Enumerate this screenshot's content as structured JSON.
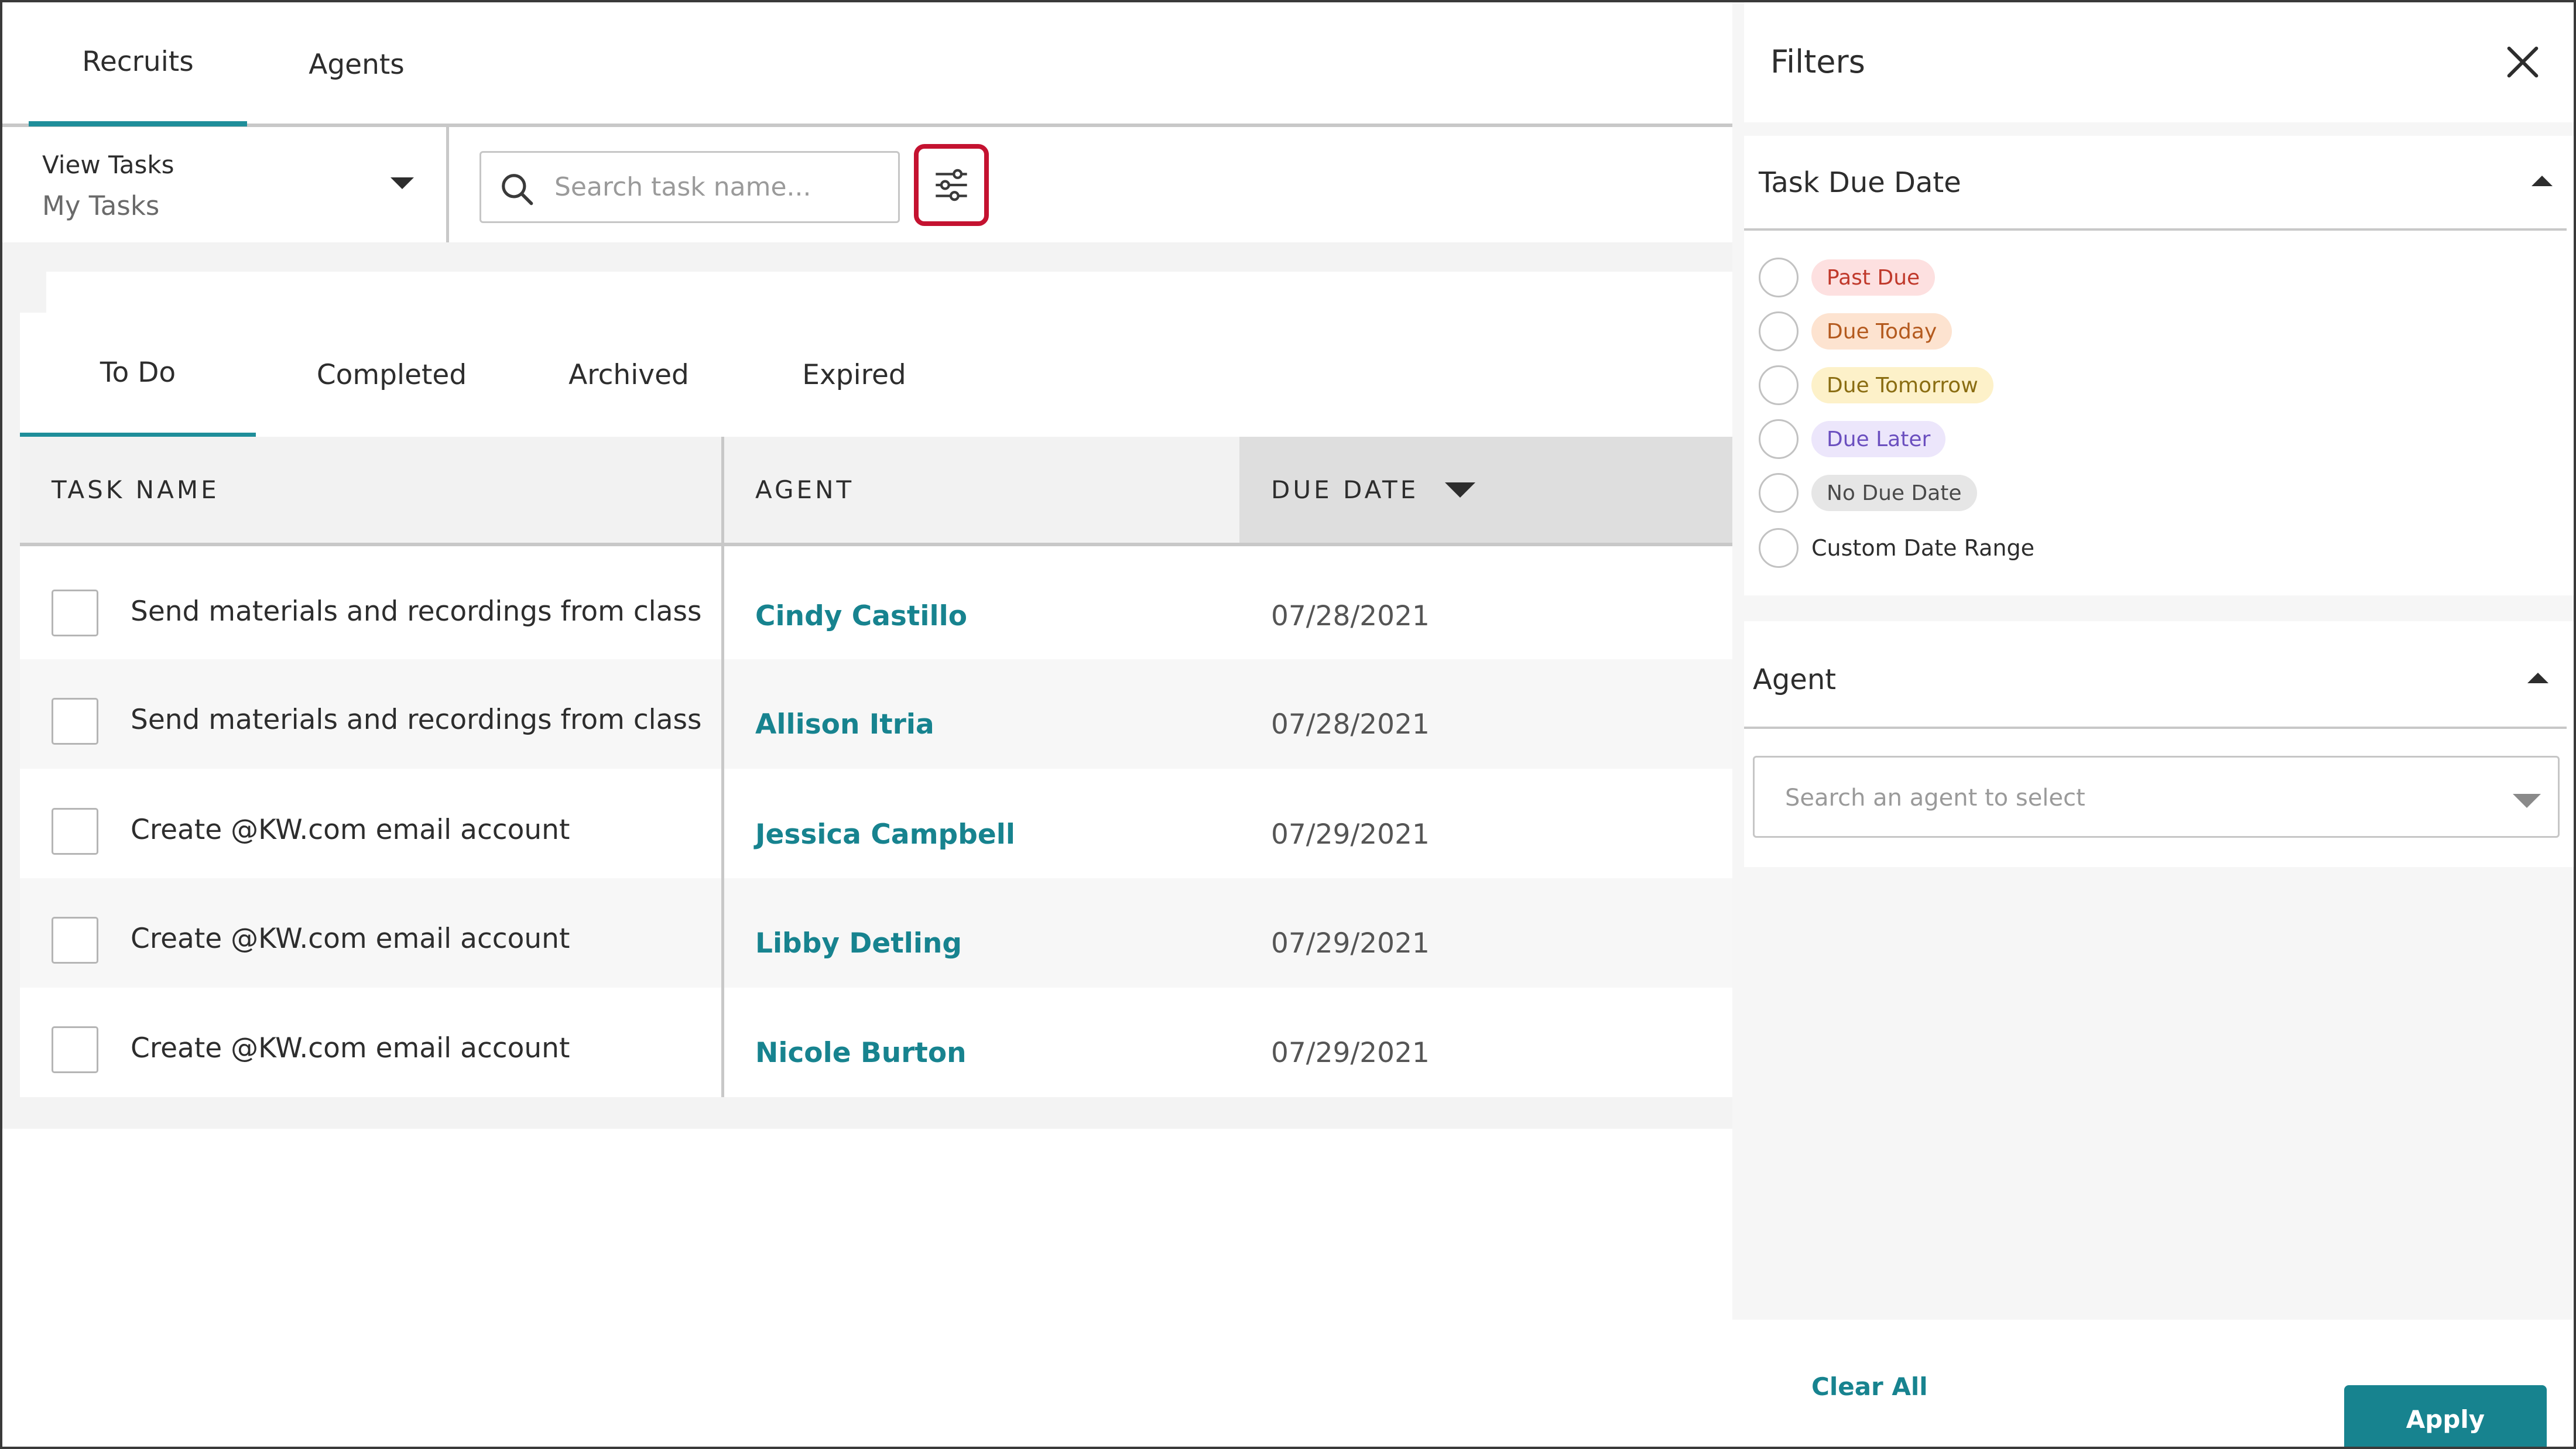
{
  "top_tabs": [
    {
      "label": "Recruits",
      "active": true
    },
    {
      "label": "Agents",
      "active": false
    }
  ],
  "view_tasks": {
    "title": "View Tasks",
    "value": "My Tasks"
  },
  "search": {
    "placeholder": "Search task name...",
    "value": ""
  },
  "filter_button": {
    "icon": "sliders-icon",
    "highlight_color": "#c41230"
  },
  "status_tabs": [
    {
      "label": "To Do",
      "active": true
    },
    {
      "label": "Completed",
      "active": false
    },
    {
      "label": "Archived",
      "active": false
    },
    {
      "label": "Expired",
      "active": false
    }
  ],
  "table": {
    "headers": {
      "task_name": "TASK NAME",
      "agent": "AGENT",
      "due_date": "DUE DATE"
    },
    "sort": {
      "column": "due_date",
      "direction": "descending"
    },
    "rows": [
      {
        "task": "Send materials and recordings from class",
        "agent": "Cindy Castillo",
        "due": "07/28/2021",
        "checked": false
      },
      {
        "task": "Send materials and recordings from class",
        "agent": "Allison Itria",
        "due": "07/28/2021",
        "checked": false
      },
      {
        "task": "Create @KW.com email account",
        "agent": "Jessica Campbell",
        "due": "07/29/2021",
        "checked": false
      },
      {
        "task": "Create @KW.com email account",
        "agent": "Libby Detling",
        "due": "07/29/2021",
        "checked": false
      },
      {
        "task": "Create @KW.com email account",
        "agent": "Nicole Burton",
        "due": "07/29/2021",
        "checked": false
      }
    ]
  },
  "filters": {
    "title": "Filters",
    "task_due_date": {
      "title": "Task Due Date",
      "options": [
        {
          "label": "Past Due",
          "bg": "#fde0e0",
          "fg": "#c0392b"
        },
        {
          "label": "Due Today",
          "bg": "#fde3d0",
          "fg": "#b45a1e"
        },
        {
          "label": "Due Tomorrow",
          "bg": "#fdf1c9",
          "fg": "#8a6d12"
        },
        {
          "label": "Due Later",
          "bg": "#ece6fb",
          "fg": "#6b4fbf"
        },
        {
          "label": "No Due Date",
          "bg": "#e6e6e6",
          "fg": "#4a4a4a"
        }
      ],
      "custom": "Custom Date Range"
    },
    "agent": {
      "title": "Agent",
      "placeholder": "Search an agent to select"
    },
    "clear_all": "Clear All",
    "apply": "Apply"
  },
  "colors": {
    "accent": "#17838f",
    "tab_underline": "#1f8e9a"
  }
}
